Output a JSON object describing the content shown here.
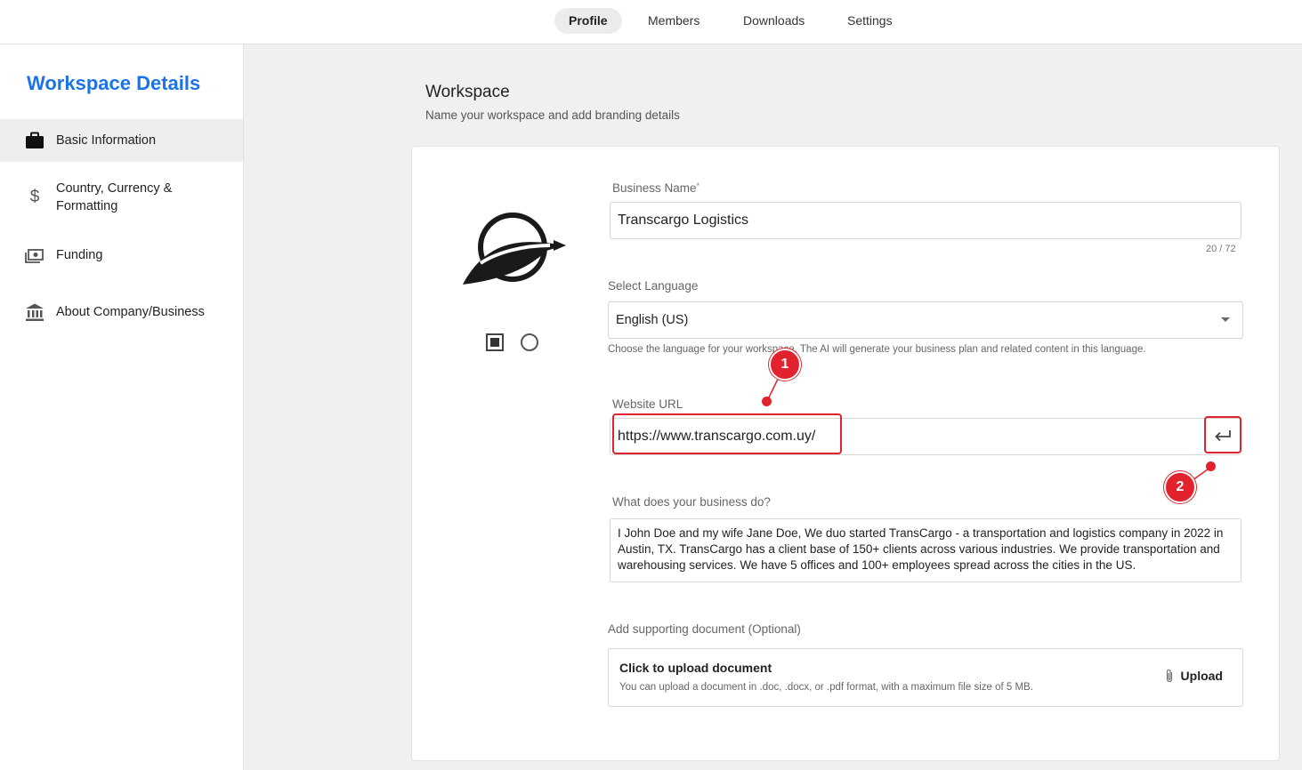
{
  "topnav": {
    "tabs": [
      {
        "label": "Profile",
        "active": true
      },
      {
        "label": "Members",
        "active": false
      },
      {
        "label": "Downloads",
        "active": false
      },
      {
        "label": "Settings",
        "active": false
      }
    ]
  },
  "sidebar": {
    "title": "Workspace Details",
    "items": [
      {
        "label": "Basic Information",
        "icon": "briefcase-icon",
        "active": true
      },
      {
        "label_line1": "Country, Currency &",
        "label_line2": "Formatting",
        "icon": "dollar-icon"
      },
      {
        "label": "Funding",
        "icon": "money-icon"
      },
      {
        "label": "About Company/Business",
        "icon": "bank-icon"
      }
    ]
  },
  "main": {
    "title": "Workspace",
    "subtitle": "Name your workspace and add branding details",
    "business_name": {
      "label": "Business Name",
      "required_mark": "*",
      "value": "Transcargo Logistics",
      "counter": "20 / 72"
    },
    "language": {
      "label": "Select Language",
      "value": "English (US)",
      "helper": "Choose the language for your workspace. The AI will generate your business plan and related content in this language."
    },
    "website": {
      "label": "Website URL",
      "value": "https://www.transcargo.com.uy/"
    },
    "business_description": {
      "label": "What does your business do?",
      "value": "I John Doe and my wife Jane Doe, We duo started TransCargo - a transportation and logistics company in 2022 in Austin, TX. TransCargo has a client base of 150+ clients across various industries. We provide transportation and warehousing services. We have 5 offices and 100+ employees spread across the cities in the US."
    },
    "document": {
      "label": "Add supporting document (Optional)",
      "title": "Click to upload document",
      "subtitle": "You can upload a document in .doc, .docx, or .pdf format, with a maximum file size of 5 MB.",
      "button": "Upload"
    }
  },
  "annotations": {
    "marker1": "1",
    "marker2": "2",
    "color": "#e2232d"
  },
  "colors": {
    "accent": "#1a73e8"
  }
}
